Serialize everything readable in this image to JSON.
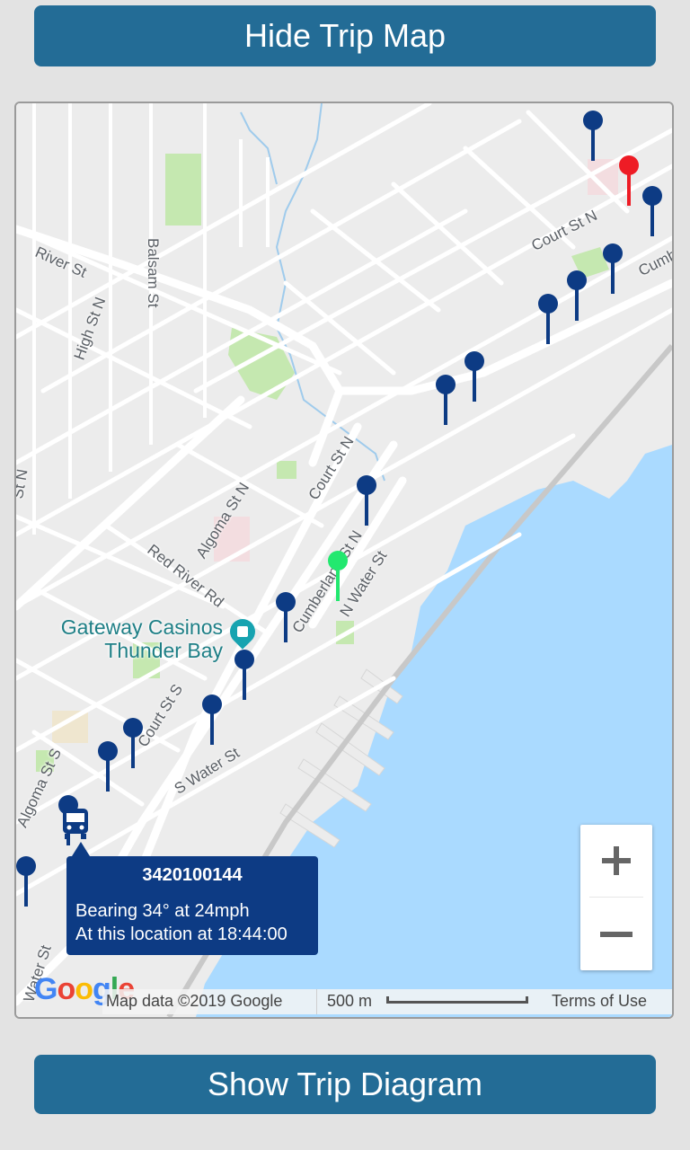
{
  "buttons": {
    "hide_trip_map": "Hide Trip Map",
    "show_trip_diagram": "Show Trip Diagram"
  },
  "map": {
    "street_labels": {
      "river_st": "River St",
      "balsam_st": "Balsam St",
      "high_st_n": "High St N",
      "court_st_n_top": "Court St N",
      "cumb_partial": "Cumb",
      "court_st_n": "Court St N",
      "algoma_st_n": "Algoma St N",
      "red_river_rd": "Red River Rd",
      "cumberland_st_n": "Cumberland St N",
      "n_water_st": "N Water St",
      "court_st_s": "Court St S",
      "s_water_st": "S Water St",
      "algoma_st_s": "Algoma St S",
      "left_st_n": "St N",
      "water_st_partial": "Water St"
    },
    "poi": {
      "name_line1": "Gateway Casinos",
      "name_line2": "Thunder Bay"
    },
    "colors": {
      "water": "#aadaff",
      "park": "#c5e8b0",
      "stop_pin": "#0d3b84",
      "current_stop_pin": "#22e86f",
      "destination_pin": "#ee1c25",
      "bus": "#0d3b84"
    }
  },
  "vehicle_popup": {
    "vehicle_id": "3420100144",
    "bearing_line": "Bearing 34° at 24mph",
    "location_line": "At this location at 18:44:00"
  },
  "zoom": {
    "zoom_in": "+",
    "zoom_out": "−"
  },
  "attribution": {
    "map_data": "Map data ©2019 Google",
    "scale": "500 m",
    "terms": "Terms of Use",
    "logo": "Google"
  }
}
